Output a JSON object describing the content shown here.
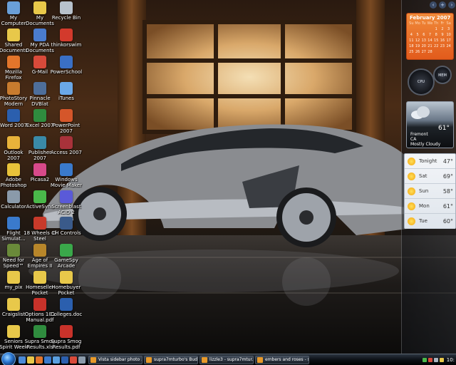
{
  "desktop_icons": [
    {
      "label": "My Computer",
      "color": "#6a9fd8"
    },
    {
      "label": "My Documents",
      "color": "#e8c84a"
    },
    {
      "label": "Recycle Bin",
      "color": "#b8c2cc"
    },
    {
      "label": "Shared Documents",
      "color": "#e8c84a"
    },
    {
      "label": "My PDA Documents",
      "color": "#4a7ccf"
    },
    {
      "label": "thinkorswim",
      "color": "#d33a2c"
    },
    {
      "label": "Mozilla Firefox",
      "color": "#e2752b"
    },
    {
      "label": "G-Mail",
      "color": "#d84a3a"
    },
    {
      "label": "PowerSchool",
      "color": "#3a6fc4"
    },
    {
      "label": "PhotoStory Modern",
      "color": "#c87b2e"
    },
    {
      "label": "Pinnacle DVBlat",
      "color": "#4e6e9a"
    },
    {
      "label": "iTunes",
      "color": "#6aa8e8"
    },
    {
      "label": "Word 2007",
      "color": "#2b5fae"
    },
    {
      "label": "Excel 2007",
      "color": "#2f8c3e"
    },
    {
      "label": "PowerPoint 2007",
      "color": "#d5562a"
    },
    {
      "label": "Outlook 2007",
      "color": "#e8b23a"
    },
    {
      "label": "Publisher 2007",
      "color": "#3a8aa8"
    },
    {
      "label": "Access 2007",
      "color": "#a8323a"
    },
    {
      "label": "Adobe Photoshop",
      "color": "#e8c23a"
    },
    {
      "label": "Picasa2",
      "color": "#d84a8a"
    },
    {
      "label": "Windows Movie Maker",
      "color": "#3a7acc"
    },
    {
      "label": "Calculator",
      "color": "#8a9aaa"
    },
    {
      "label": "ActiveSync",
      "color": "#4ab84a"
    },
    {
      "label": "Screenblast ACID 2",
      "color": "#5a5ad8"
    },
    {
      "label": "Flight Simulat...",
      "color": "#3a7acc"
    },
    {
      "label": "18 Wheels of Steel",
      "color": "#c83a2a"
    },
    {
      "label": "CH Controls",
      "color": "#3a5a8a"
    },
    {
      "label": "Need for Speed™ Mo...",
      "color": "#6a8a3a"
    },
    {
      "label": "Age of Empires II",
      "color": "#b8862a"
    },
    {
      "label": "GameSpy Arcade",
      "color": "#3aa84a"
    },
    {
      "label": "my_pix",
      "color": "#e8c84a"
    },
    {
      "label": "Homeseller Pocket",
      "color": "#e8c84a"
    },
    {
      "label": "Homebuyer Pocket",
      "color": "#e8c84a"
    },
    {
      "label": "Craigslist",
      "color": "#e8c84a"
    },
    {
      "label": "Options 101 Manual.pdf",
      "color": "#c8322a"
    },
    {
      "label": "Colleges.doc",
      "color": "#2b5fae"
    },
    {
      "label": "Seniors Spirit Week",
      "color": "#e8c84a"
    },
    {
      "label": "Supra Smog Results.xls",
      "color": "#2f8c3e"
    },
    {
      "label": "Supra Smog Results.pdf",
      "color": "#c8322a"
    }
  ],
  "sidebar": {
    "calendar": {
      "month": "February 2007",
      "weekdays": [
        "Su",
        "Mo",
        "Tu",
        "We",
        "Th",
        "Fr",
        "Sa"
      ],
      "days": [
        "",
        "",
        "",
        "",
        "1",
        "2",
        "3",
        "4",
        "5",
        "6",
        "7",
        "8",
        "9",
        "10",
        "11",
        "12",
        "13",
        "14",
        "15",
        "16",
        "17",
        "18",
        "19",
        "20",
        "21",
        "22",
        "23",
        "24",
        "25",
        "26",
        "27",
        "28",
        "",
        ""
      ],
      "big_day": "16"
    },
    "gauges": {
      "cpu": "CPU",
      "mem": "MEM"
    },
    "weather": {
      "temp": "61°",
      "city": "Fremont",
      "state": "CA",
      "condition": "Mostly Cloudy"
    },
    "forecast": [
      {
        "day": "Tonight",
        "temp": "47°"
      },
      {
        "day": "Sat",
        "temp": "69°"
      },
      {
        "day": "Sun",
        "temp": "58°"
      },
      {
        "day": "Mon",
        "temp": "61°"
      },
      {
        "day": "Tue",
        "temp": "60°"
      }
    ]
  },
  "taskbar": {
    "tasks": [
      {
        "label": "Vista sidebar photo ..."
      },
      {
        "label": "supra7mturbo's Bud..."
      },
      {
        "label": "lizzle3 - supra7mtur..."
      },
      {
        "label": "embers and roses - s..."
      }
    ],
    "clock": "10:"
  }
}
